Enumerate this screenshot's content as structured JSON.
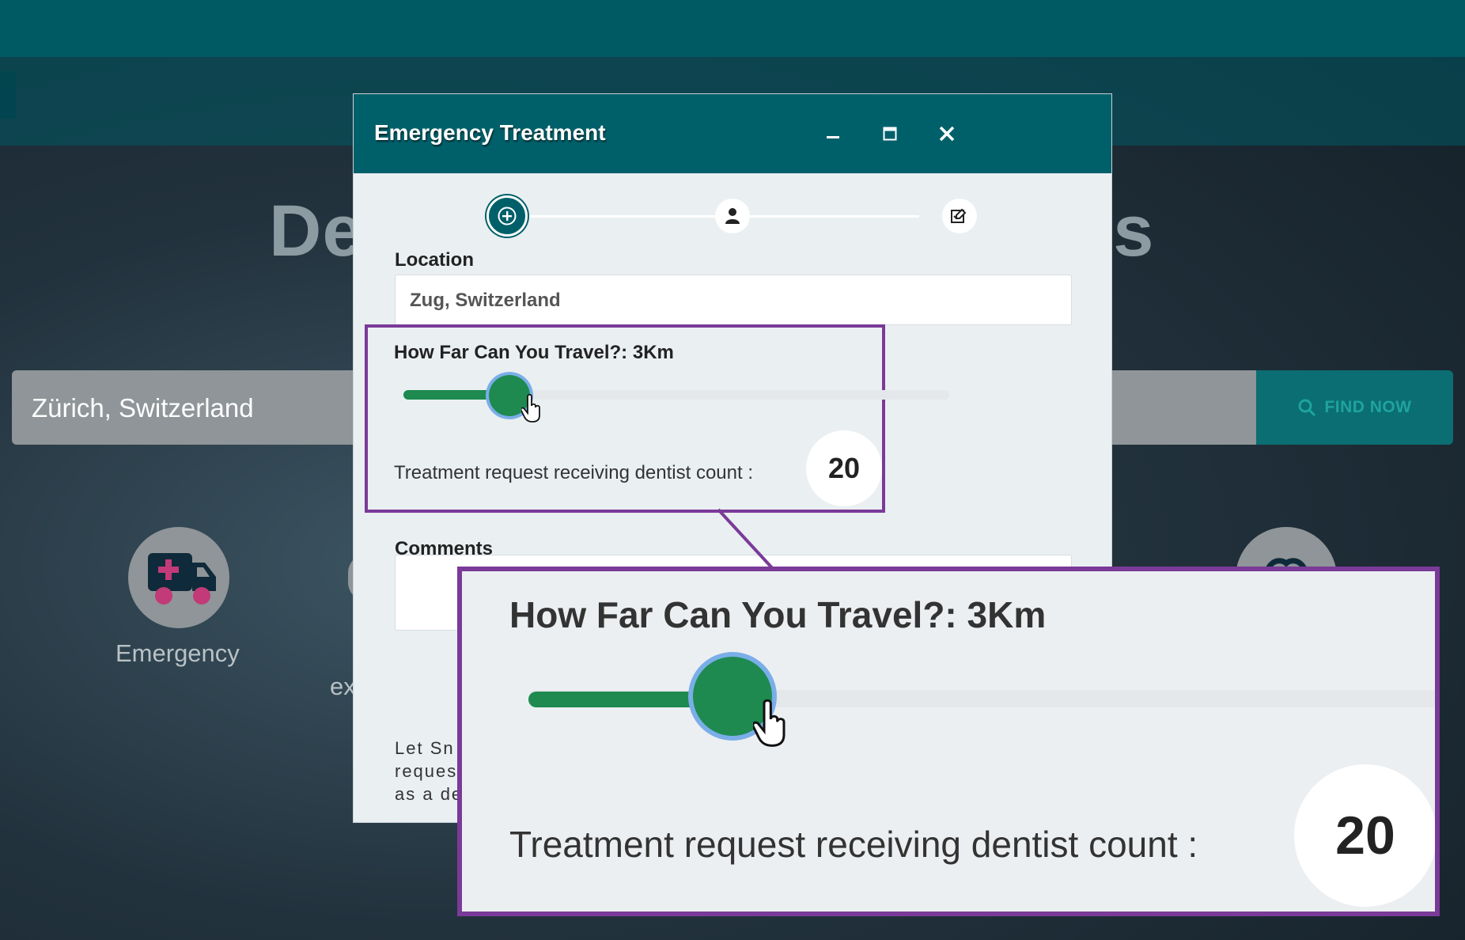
{
  "background": {
    "hero_title_left": "De",
    "hero_title_right": "gs",
    "search_value": "Zürich, Switzerland",
    "find_button": "FIND NOW",
    "services": [
      {
        "label": "Emergency",
        "icon": "ambulance-icon"
      },
      {
        "label": "ex",
        "icon": "circle-icon"
      },
      {
        "label": "",
        "icon": "tooth-icon"
      }
    ]
  },
  "modal": {
    "title": "Emergency Treatment",
    "steps": [
      {
        "icon": "plus-circle-icon",
        "active": true
      },
      {
        "icon": "person-icon",
        "active": false
      },
      {
        "icon": "edit-check-icon",
        "active": false
      }
    ],
    "location_label": "Location",
    "location_value": "Zug, Switzerland",
    "travel_label": "How Far Can You Travel?: 3Km",
    "travel_distance_km": 3,
    "travel_slider_fraction": 0.16,
    "count_label": "Treatment request receiving dentist count  :",
    "count_value": "20",
    "comments_label": "Comments",
    "footer_text_lines": [
      "Let  Sn",
      "reques",
      "as a de"
    ]
  },
  "zoom": {
    "travel_label": "How Far Can You Travel?: 3Km",
    "count_label": "Treatment request receiving dentist count  :",
    "count_value": "20"
  },
  "colors": {
    "header": "#00606a",
    "slider": "#1e8a50",
    "highlight": "#7a3a98"
  }
}
